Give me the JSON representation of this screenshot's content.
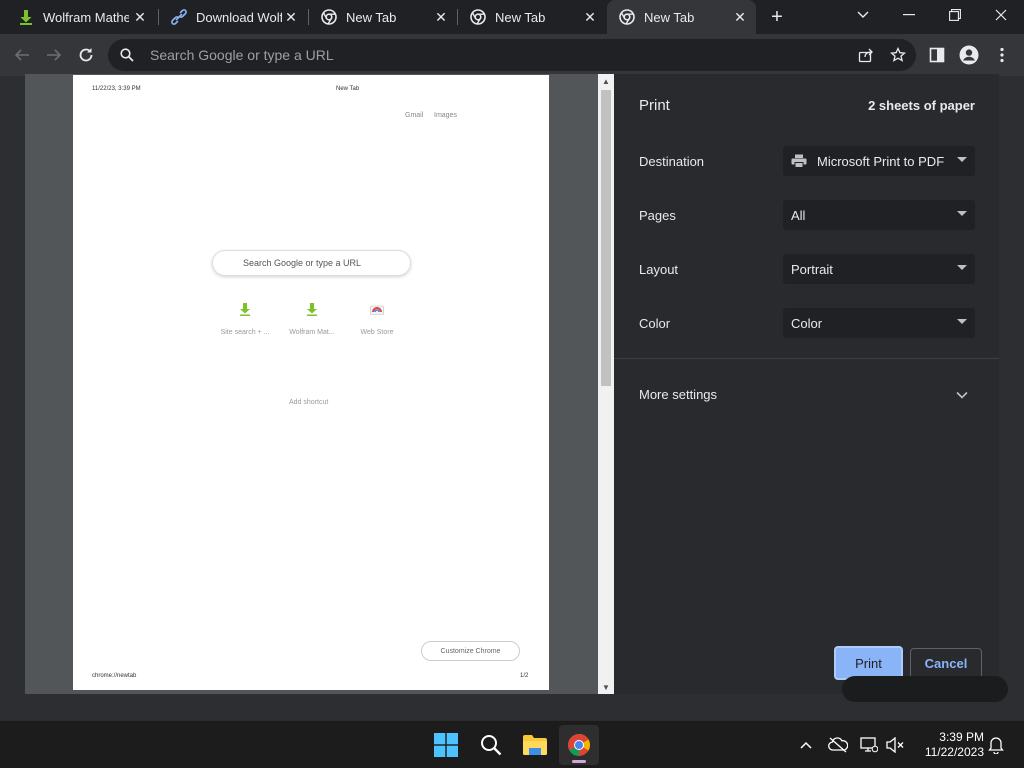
{
  "tabs": [
    {
      "title": "Wolfram Mathem",
      "icon": "download-arrow-icon"
    },
    {
      "title": "Download Wolfr",
      "icon": "link-icon"
    },
    {
      "title": "New Tab",
      "icon": "chrome-icon"
    },
    {
      "title": "New Tab",
      "icon": "chrome-icon"
    },
    {
      "title": "New Tab",
      "icon": "chrome-icon",
      "active": true
    }
  ],
  "omnibox": {
    "placeholder": "Search Google or type a URL"
  },
  "preview": {
    "date": "11/22/23, 3:39 PM",
    "page_title": "New Tab",
    "gmail": "Gmail",
    "images": "Images",
    "search_placeholder": "Search Google or type a URL",
    "shortcuts": [
      {
        "label": "Site search + ...",
        "icon": "download-arrow-icon"
      },
      {
        "label": "Wolfram Mat...",
        "icon": "download-arrow-icon"
      },
      {
        "label": "Web Store",
        "icon": "web-store-icon"
      }
    ],
    "add_shortcut": "Add shortcut",
    "customize": "Customize Chrome",
    "url": "chrome://newtab",
    "page_number": "1/2"
  },
  "print": {
    "title": "Print",
    "sheets": "2 sheets of paper",
    "destination_label": "Destination",
    "destination_value": "Microsoft Print to PDF",
    "pages_label": "Pages",
    "pages_value": "All",
    "layout_label": "Layout",
    "layout_value": "Portrait",
    "color_label": "Color",
    "color_value": "Color",
    "more_settings": "More settings",
    "print_button": "Print",
    "cancel_button": "Cancel"
  },
  "taskbar": {
    "time": "3:39 PM",
    "date": "11/22/2023"
  },
  "colors": {
    "accent": "#8ab4f8",
    "dialog_bg": "#292a2d",
    "toolbar_bg": "#35363a"
  }
}
